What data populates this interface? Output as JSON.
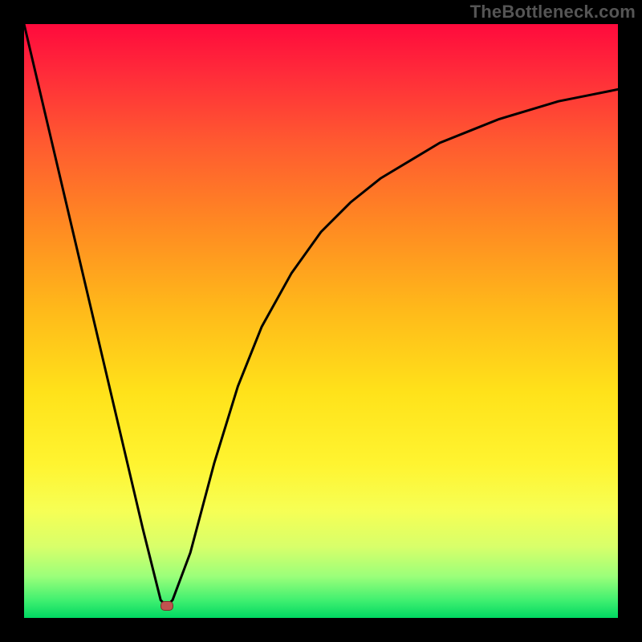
{
  "watermark": "TheBottleneck.com",
  "colors": {
    "frame_bg": "#000000",
    "curve": "#000000",
    "marker_fill": "#c0524f",
    "marker_border": "#7a2e2c",
    "gradient_top": "#ff0a3c",
    "gradient_bottom": "#00d862"
  },
  "chart_data": {
    "type": "line",
    "title": "",
    "xlabel": "",
    "ylabel": "",
    "xlim": [
      0,
      100
    ],
    "ylim": [
      0,
      100
    ],
    "grid": false,
    "legend": false,
    "annotations": [
      {
        "kind": "marker",
        "x": 24,
        "y": 2
      }
    ],
    "series": [
      {
        "name": "curve",
        "x": [
          0,
          4,
          8,
          12,
          16,
          20,
          23,
          24,
          25,
          28,
          32,
          36,
          40,
          45,
          50,
          55,
          60,
          65,
          70,
          75,
          80,
          85,
          90,
          95,
          100
        ],
        "y": [
          100,
          83,
          66,
          49,
          32,
          15,
          3,
          2,
          3,
          11,
          26,
          39,
          49,
          58,
          65,
          70,
          74,
          77,
          80,
          82,
          84,
          85.5,
          87,
          88,
          89
        ]
      }
    ],
    "background_gradient_meaning": "red (top) = high bottleneck, green (bottom) = no bottleneck"
  }
}
